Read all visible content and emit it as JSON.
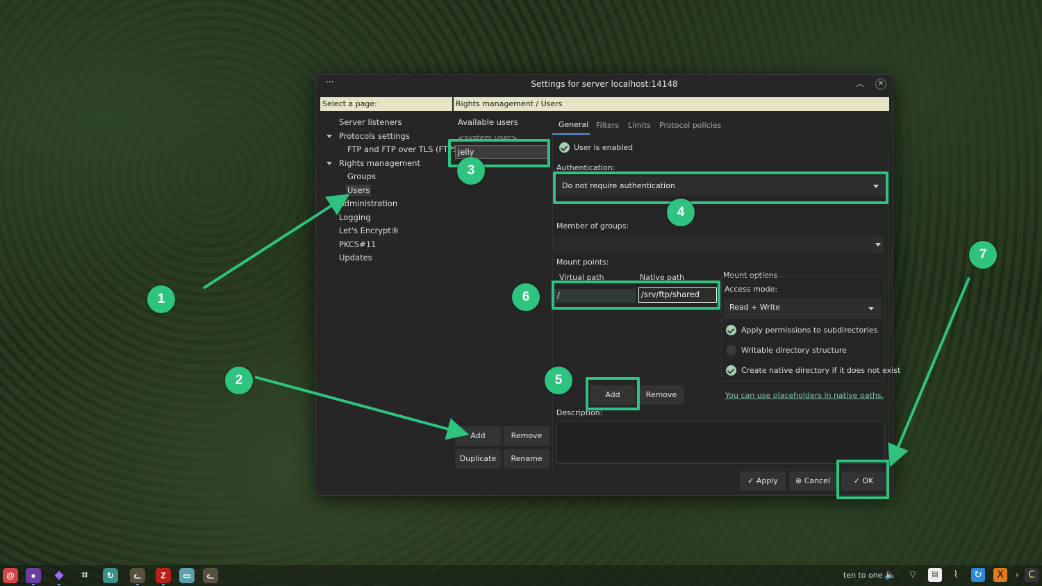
{
  "window": {
    "title": "Settings for server localhost:14148",
    "menu_glyph": "···",
    "collapse_glyph": "︿",
    "close_glyph": "✕"
  },
  "page_selector": {
    "header": "Select a page:",
    "items": {
      "server_listeners": "Server listeners",
      "protocols_settings": "Protocols settings",
      "ftp_ftps": "FTP and FTP over TLS (FTPS)",
      "rights_management": "Rights management",
      "groups": "Groups",
      "users": "Users",
      "administration": "Administration",
      "logging": "Logging",
      "lets_encrypt": "Let's Encrypt®",
      "pkcs11": "PKCS#11",
      "updates": "Updates"
    }
  },
  "content": {
    "header": "Rights management / Users",
    "available_users_label": "Available users",
    "system_users": "<system user>",
    "selected_user": "jelly",
    "user_buttons": {
      "add": "Add",
      "remove": "Remove",
      "duplicate": "Duplicate",
      "rename": "Rename"
    },
    "tabs": {
      "general": "General",
      "filters": "Filters",
      "limits": "Limits",
      "protocol_policies": "Protocol policies"
    },
    "user_enabled_label": "User is enabled",
    "user_enabled": true,
    "authentication_label": "Authentication:",
    "authentication_value": "Do not require authentication",
    "member_of_groups_label": "Member of groups:",
    "mount_points_label": "Mount points:",
    "mount_columns": {
      "virtual": "Virtual path",
      "native": "Native path"
    },
    "mount_row": {
      "virtual": "/",
      "native": "/srv/ftp/shared"
    },
    "mount_options_label": "Mount options",
    "access_mode_label": "Access mode:",
    "access_mode_value": "Read + Write",
    "options": {
      "apply_subdirs": "Apply permissions to subdirectories",
      "writable_structure": "Writable directory structure",
      "create_native": "Create native directory if it does not exist"
    },
    "option_states": {
      "apply_subdirs": true,
      "writable_structure": false,
      "create_native": true
    },
    "mount_buttons": {
      "add": "Add",
      "remove": "Remove"
    },
    "placeholders_link": "You can use placeholders in native paths.",
    "description_label": "Description:"
  },
  "footer_buttons": {
    "apply": "Apply",
    "cancel": "Cancel",
    "ok": "OK"
  },
  "annotations": {
    "accent_color": "#2ec37e",
    "steps": [
      "1",
      "2",
      "3",
      "4",
      "5",
      "6",
      "7"
    ]
  },
  "taskbar": {
    "clock": "ten to one",
    "apps": [
      "debian-icon",
      "firefox-icon",
      "obsidian-icon",
      "screenshot-icon",
      "sync-icon",
      "cat-icon",
      "filezilla-icon",
      "files-icon",
      "cat-icon"
    ]
  }
}
